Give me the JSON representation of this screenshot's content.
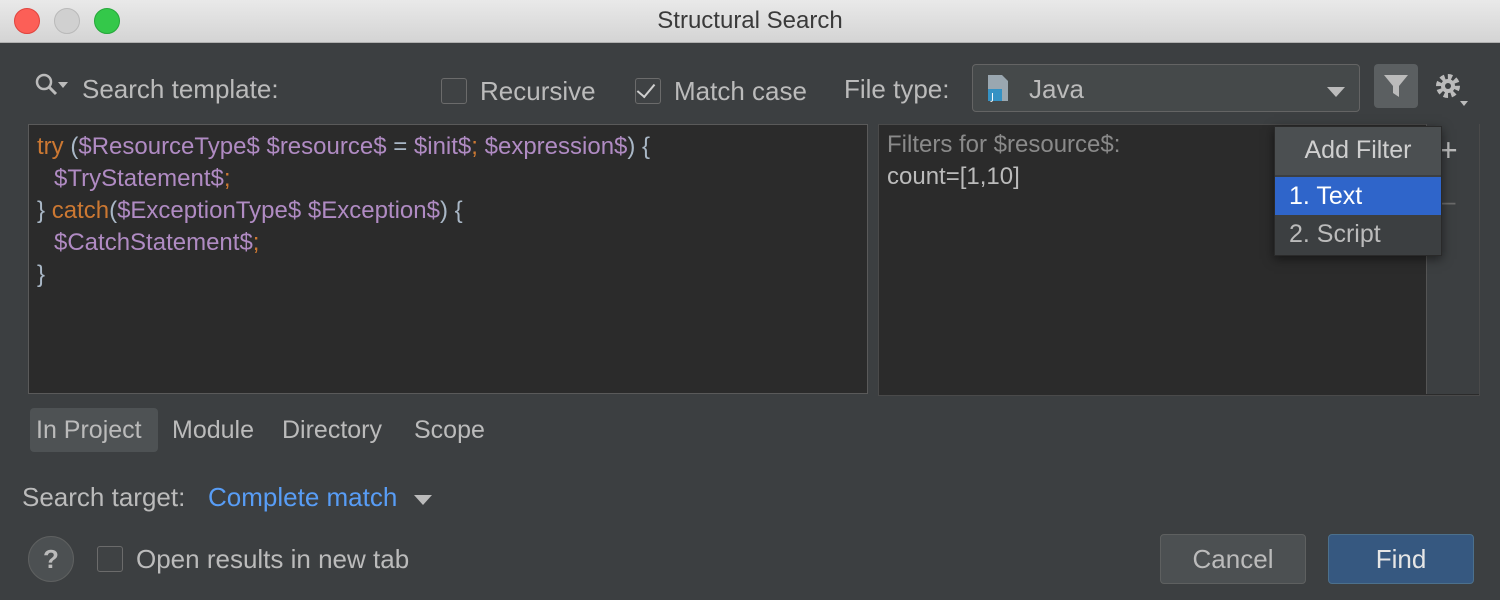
{
  "window": {
    "title": "Structural Search"
  },
  "toolbar": {
    "search_template_label": "Search template:",
    "recursive_label": "Recursive",
    "recursive_checked": false,
    "match_case_label": "Match case",
    "match_case_checked": true,
    "file_type_label": "File type:",
    "file_type_value": "Java"
  },
  "editor": {
    "line1": {
      "kw1": "try",
      "p1": " (",
      "v1": "$ResourceType$",
      "sp1": " ",
      "v2": "$resource$",
      "p2": " = ",
      "v3": "$init$",
      "k2": ";",
      "sp2": " ",
      "v4": "$expression$",
      "p3": ") {"
    },
    "line2": {
      "v1": "$TryStatement$",
      "k1": ";"
    },
    "line3": {
      "p1": "} ",
      "kw1": "catch",
      "p2": "(",
      "v1": "$ExceptionType$",
      "sp1": " ",
      "v2": "$Exception$",
      "p3": ") {"
    },
    "line4": {
      "v1": "$CatchStatement$",
      "k1": ";"
    },
    "line5": {
      "p1": "}"
    }
  },
  "filters": {
    "title": "Filters for $resource$:",
    "value": "count=[1,10]",
    "add_icon": "+",
    "remove_icon": "–"
  },
  "add_filter_popup": {
    "title": "Add Filter",
    "items": [
      "1. Text",
      "2. Script"
    ],
    "selected_index": 0
  },
  "scope": {
    "tabs": [
      "In Project",
      "Module",
      "Directory",
      "Scope"
    ],
    "selected": "In Project"
  },
  "search_target": {
    "label": "Search target:",
    "value": "Complete match"
  },
  "footer": {
    "help_label": "?",
    "open_new_tab_label": "Open results in new tab",
    "open_new_tab_checked": false,
    "cancel_label": "Cancel",
    "find_label": "Find"
  },
  "colors": {
    "background": "#3c3f41",
    "editor_bg": "#2b2b2b",
    "keyword": "#cc7832",
    "variable": "#b08bc3",
    "link": "#589df6",
    "selection": "#2f65ca",
    "primary_button": "#365880"
  }
}
